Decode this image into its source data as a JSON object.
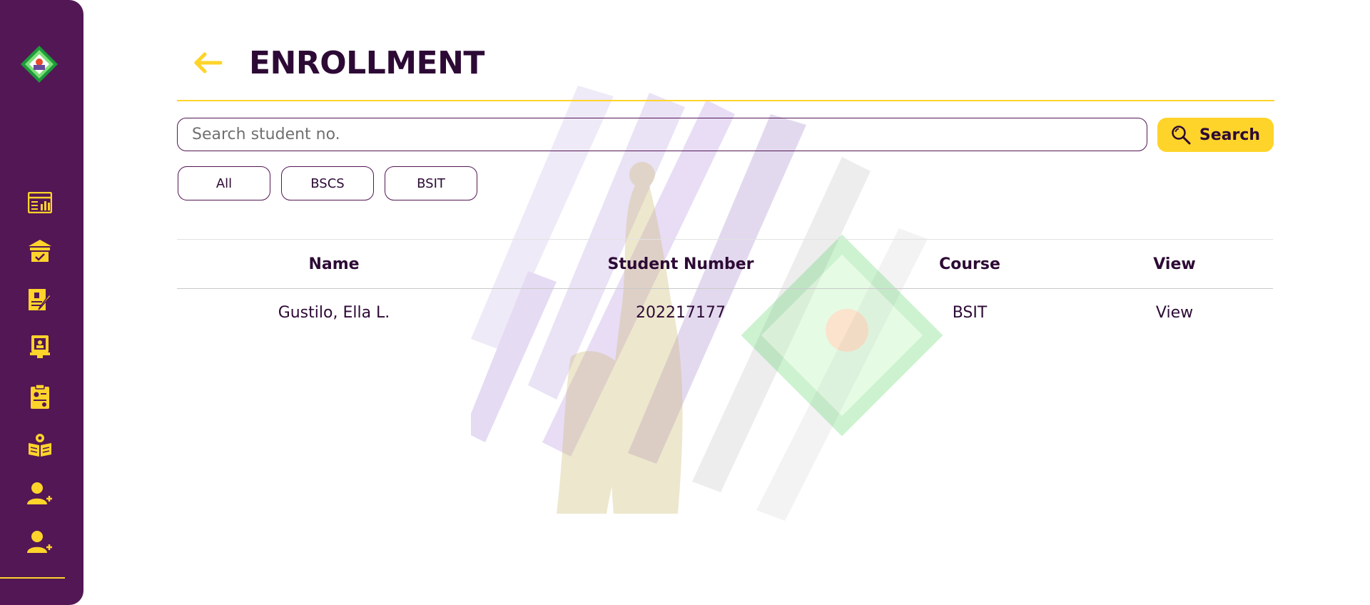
{
  "page": {
    "title": "ENROLLMENT"
  },
  "search": {
    "placeholder": "Search student no.",
    "value": "",
    "button_label": "Search"
  },
  "filters": [
    "All",
    "BSCS",
    "BSIT"
  ],
  "table": {
    "columns": [
      "Name",
      "Student Number",
      "Course",
      "View"
    ],
    "rows": [
      {
        "name": "Gustilo, Ella L.",
        "student_number": "202217177",
        "course": "BSIT",
        "view": "View"
      }
    ]
  },
  "sidebar": {
    "icons": [
      "dashboard-icon",
      "school-building-icon",
      "enrollment-form-icon",
      "monitor-icon",
      "clipboard-report-icon",
      "open-book-icon",
      "add-user-icon",
      "add-user-icon"
    ]
  },
  "colors": {
    "sidebar": "#531755",
    "accent": "#ffd42a",
    "text": "#2d0a35"
  }
}
